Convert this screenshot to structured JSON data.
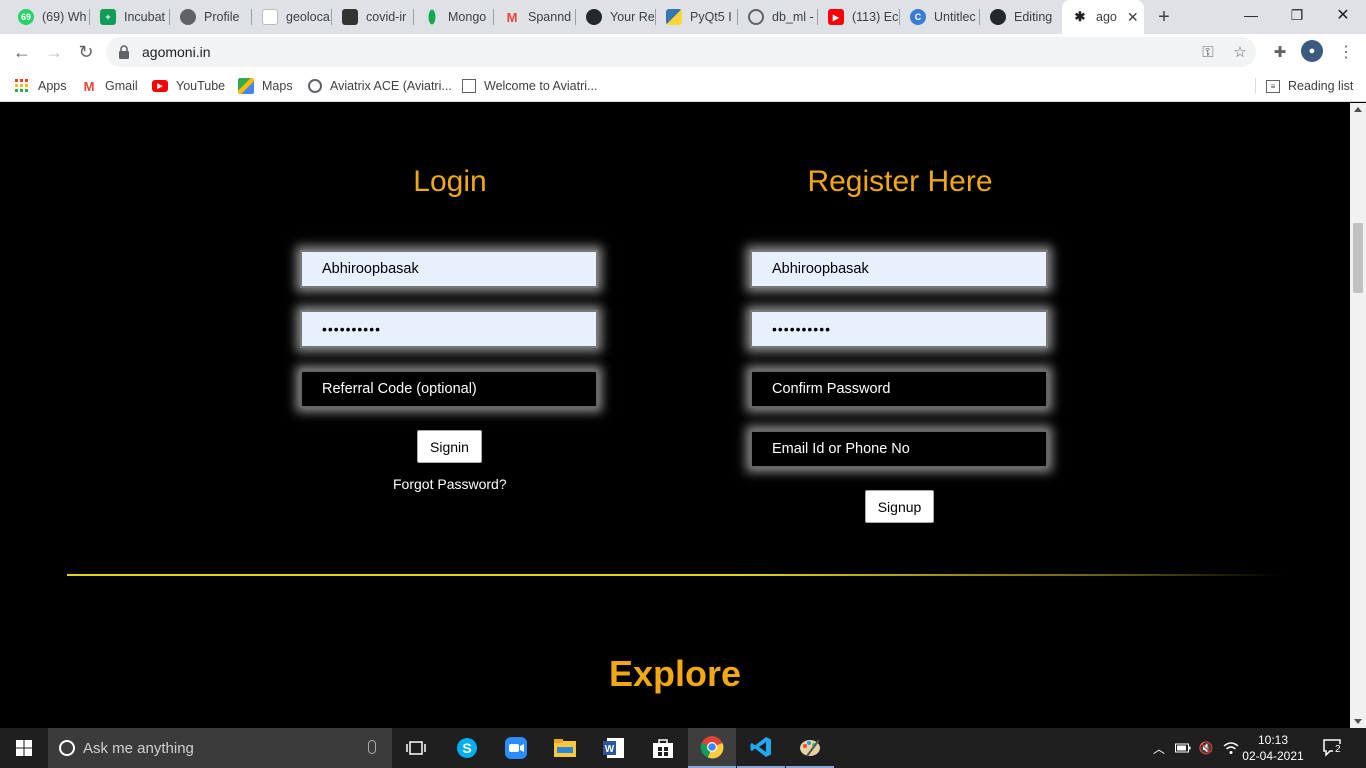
{
  "browser": {
    "tabs": [
      {
        "label": "(69) Wh",
        "favicon": "whatsapp-icon",
        "color": "#25d366"
      },
      {
        "label": "Incubat",
        "favicon": "sheets-icon",
        "color": "#0f9d58"
      },
      {
        "label": "Profile",
        "favicon": "globe-icon",
        "color": "#5f6368"
      },
      {
        "label": "geoloca",
        "favicon": "page-icon",
        "color": "#ffffff"
      },
      {
        "label": "covid-ir",
        "favicon": "dataset-icon",
        "color": "#333333"
      },
      {
        "label": "Mongo",
        "favicon": "mongodb-icon",
        "color": "#13aa52"
      },
      {
        "label": "Spannd",
        "favicon": "gmail-icon",
        "color": "#ea4335"
      },
      {
        "label": "Your Re",
        "favicon": "github-icon",
        "color": "#24292e"
      },
      {
        "label": "PyQt5 I",
        "favicon": "python-icon",
        "color": "#3776ab"
      },
      {
        "label": "db_ml -",
        "favicon": "colab-icon",
        "color": "#5f6368"
      },
      {
        "label": "(113) Ec",
        "favicon": "youtube-icon",
        "color": "#ff0000"
      },
      {
        "label": "Untitlec",
        "favicon": "canva-icon",
        "color": "#3a7bd5"
      },
      {
        "label": "Editing",
        "favicon": "github-icon",
        "color": "#24292e"
      },
      {
        "label": "ago",
        "favicon": "agomoni-icon",
        "color": "#202124"
      }
    ],
    "new_tab_label": "+",
    "url": "agomoni.in"
  },
  "bookmarks": [
    {
      "label": "Apps",
      "icon": "apps-grid-icon"
    },
    {
      "label": "Gmail",
      "icon": "gmail-icon"
    },
    {
      "label": "YouTube",
      "icon": "youtube-icon"
    },
    {
      "label": "Maps",
      "icon": "maps-icon"
    },
    {
      "label": "Aviatrix ACE (Aviatri...",
      "icon": "globe-icon"
    },
    {
      "label": "Welcome to Aviatri...",
      "icon": "page-icon"
    },
    {
      "label": "Reading list",
      "icon": "reading-list-icon"
    }
  ],
  "login": {
    "title": "Login",
    "username_value": "Abhiroopbasak",
    "password_value": "••••••••••",
    "referral_placeholder": "Referral Code (optional)",
    "signin_label": "Signin",
    "forgot_label": "Forgot Password?"
  },
  "register": {
    "title": "Register Here",
    "username_value": "Abhiroopbasak",
    "password_value": "••••••••••",
    "confirm_placeholder": "Confirm Password",
    "contact_placeholder": "Email Id or Phone No",
    "signup_label": "Signup"
  },
  "explore": {
    "title": "Explore"
  },
  "colors": {
    "accent": "#f2a813",
    "divider": "#e8d51a",
    "field_fill": "#e8f0fe"
  },
  "taskbar": {
    "search_placeholder": "Ask me anything",
    "time": "10:13",
    "date": "02-04-2021",
    "notification_count": "2"
  }
}
